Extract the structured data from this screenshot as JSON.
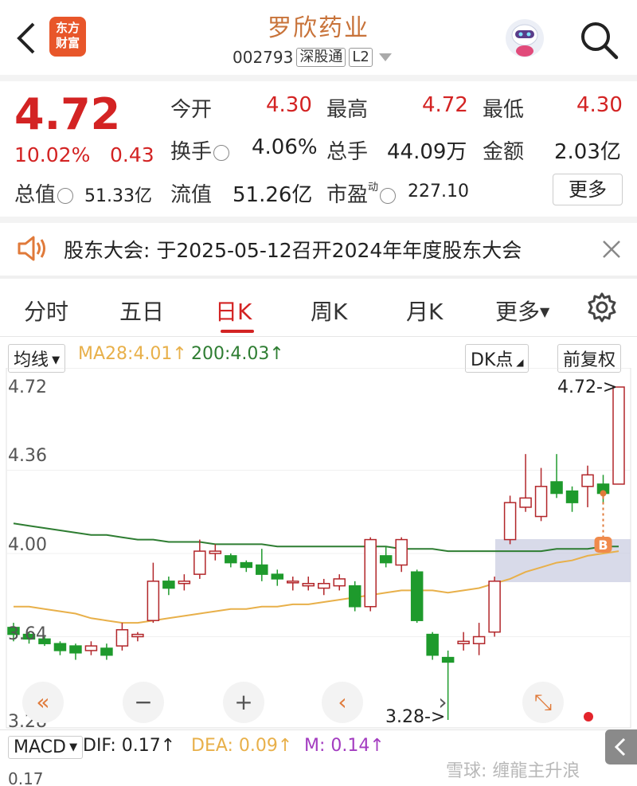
{
  "header": {
    "back_icon": "chevron-left-icon",
    "app_logo_line1": "东方",
    "app_logo_line2": "财富",
    "title": "罗欣药业",
    "code": "002793",
    "tag_connect": "深股通",
    "tag_level": "L2",
    "search_icon": "search-icon",
    "robot_icon": "robot-avatar-icon"
  },
  "quote": {
    "price": "4.72",
    "change_pct": "10.02%",
    "change_abs": "0.43",
    "open_label": "今开",
    "open": "4.30",
    "high_label": "最高",
    "high": "4.72",
    "low_label": "最低",
    "low": "4.30",
    "turnover_label": "换手",
    "turnover": "4.06%",
    "volume_label": "总手",
    "volume": "44.09万",
    "amount_label": "金额",
    "amount": "2.03亿",
    "mktcap_label": "总值",
    "mktcap": "51.33亿",
    "float_label": "流值",
    "float": "51.26亿",
    "pe_label": "市盈",
    "pe_sup": "动",
    "pe": "227.10",
    "more_label": "更多"
  },
  "notice": {
    "text": "股东大会: 于2025-05-12召开2024年年度股东大会"
  },
  "tabs": [
    "分时",
    "五日",
    "日K",
    "周K",
    "月K",
    "更多"
  ],
  "active_tab": "日K",
  "ma": {
    "selector": "均线",
    "ma28": "MA28:4.01",
    "ma200": "200:4.03",
    "dk_label": "DK点",
    "adjust_label": "前复权"
  },
  "chart_data": {
    "type": "candlestick",
    "y_ticks": [
      "4.72",
      "4.36",
      "4.00",
      "3.64",
      "3.28"
    ],
    "ylim": [
      3.28,
      4.72
    ],
    "max_marker": "4.72->",
    "min_marker": "3.28->",
    "buy_marker": "B",
    "candles": [
      {
        "o": 3.68,
        "c": 3.65,
        "h": 3.7,
        "l": 3.62
      },
      {
        "o": 3.65,
        "c": 3.63,
        "h": 3.66,
        "l": 3.61
      },
      {
        "o": 3.63,
        "c": 3.61,
        "h": 3.64,
        "l": 3.6
      },
      {
        "o": 3.61,
        "c": 3.58,
        "h": 3.62,
        "l": 3.56
      },
      {
        "o": 3.6,
        "c": 3.57,
        "h": 3.61,
        "l": 3.54
      },
      {
        "o": 3.58,
        "c": 3.6,
        "h": 3.62,
        "l": 3.56
      },
      {
        "o": 3.59,
        "c": 3.56,
        "h": 3.61,
        "l": 3.54
      },
      {
        "o": 3.6,
        "c": 3.67,
        "h": 3.7,
        "l": 3.58
      },
      {
        "o": 3.64,
        "c": 3.65,
        "h": 3.66,
        "l": 3.62
      },
      {
        "o": 3.71,
        "c": 3.88,
        "h": 3.96,
        "l": 3.7
      },
      {
        "o": 3.88,
        "c": 3.85,
        "h": 3.9,
        "l": 3.82
      },
      {
        "o": 3.87,
        "c": 3.88,
        "h": 3.91,
        "l": 3.84
      },
      {
        "o": 3.91,
        "c": 4.01,
        "h": 4.06,
        "l": 3.89
      },
      {
        "o": 4.0,
        "c": 4.01,
        "h": 4.04,
        "l": 3.97
      },
      {
        "o": 3.99,
        "c": 3.96,
        "h": 4.0,
        "l": 3.94
      },
      {
        "o": 3.96,
        "c": 3.94,
        "h": 3.97,
        "l": 3.92
      },
      {
        "o": 3.95,
        "c": 3.91,
        "h": 4.02,
        "l": 3.88
      },
      {
        "o": 3.91,
        "c": 3.89,
        "h": 3.93,
        "l": 3.86
      },
      {
        "o": 3.88,
        "c": 3.88,
        "h": 3.9,
        "l": 3.84
      },
      {
        "o": 3.86,
        "c": 3.87,
        "h": 3.9,
        "l": 3.84
      },
      {
        "o": 3.85,
        "c": 3.87,
        "h": 3.89,
        "l": 3.82
      },
      {
        "o": 3.86,
        "c": 3.89,
        "h": 3.91,
        "l": 3.84
      },
      {
        "o": 3.86,
        "c": 3.77,
        "h": 3.88,
        "l": 3.75
      },
      {
        "o": 3.77,
        "c": 4.06,
        "h": 4.07,
        "l": 3.75
      },
      {
        "o": 3.99,
        "c": 3.96,
        "h": 4.03,
        "l": 3.94
      },
      {
        "o": 3.95,
        "c": 4.06,
        "h": 4.07,
        "l": 3.92
      },
      {
        "o": 3.92,
        "c": 3.71,
        "h": 3.93,
        "l": 3.7
      },
      {
        "o": 3.65,
        "c": 3.56,
        "h": 3.66,
        "l": 3.54
      },
      {
        "o": 3.55,
        "c": 3.53,
        "h": 3.58,
        "l": 3.28
      },
      {
        "o": 3.61,
        "c": 3.62,
        "h": 3.66,
        "l": 3.58
      },
      {
        "o": 3.61,
        "c": 3.64,
        "h": 3.7,
        "l": 3.56
      },
      {
        "o": 3.66,
        "c": 3.88,
        "h": 3.9,
        "l": 3.64
      },
      {
        "o": 4.06,
        "c": 4.22,
        "h": 4.25,
        "l": 4.04
      },
      {
        "o": 4.2,
        "c": 4.24,
        "h": 4.43,
        "l": 4.18
      },
      {
        "o": 4.16,
        "c": 4.29,
        "h": 4.37,
        "l": 4.14
      },
      {
        "o": 4.31,
        "c": 4.26,
        "h": 4.43,
        "l": 4.24
      },
      {
        "o": 4.27,
        "c": 4.22,
        "h": 4.29,
        "l": 4.18
      },
      {
        "o": 4.29,
        "c": 4.34,
        "h": 4.38,
        "l": 4.2
      },
      {
        "o": 4.3,
        "c": 4.26,
        "h": 4.34,
        "l": 4.22
      },
      {
        "o": 4.3,
        "c": 4.72,
        "h": 4.72,
        "l": 4.3
      }
    ],
    "ma28": [
      3.77,
      3.77,
      3.76,
      3.75,
      3.74,
      3.72,
      3.71,
      3.7,
      3.7,
      3.71,
      3.72,
      3.73,
      3.74,
      3.75,
      3.76,
      3.76,
      3.77,
      3.77,
      3.78,
      3.78,
      3.79,
      3.8,
      3.81,
      3.82,
      3.83,
      3.84,
      3.84,
      3.84,
      3.83,
      3.84,
      3.85,
      3.87,
      3.89,
      3.92,
      3.94,
      3.96,
      3.97,
      3.99,
      4.0,
      4.01
    ],
    "ma200": [
      4.13,
      4.12,
      4.11,
      4.1,
      4.09,
      4.08,
      4.08,
      4.07,
      4.06,
      4.06,
      4.05,
      4.05,
      4.05,
      4.04,
      4.04,
      4.04,
      4.04,
      4.03,
      4.03,
      4.03,
      4.03,
      4.03,
      4.03,
      4.03,
      4.03,
      4.02,
      4.02,
      4.02,
      4.01,
      4.01,
      4.01,
      4.01,
      4.01,
      4.01,
      4.01,
      4.02,
      4.02,
      4.02,
      4.03,
      4.03
    ]
  },
  "controls": [
    "«",
    "−",
    "+",
    "‹",
    "›",
    "⤡"
  ],
  "macd": {
    "selector": "MACD",
    "dif": "DIF: 0.17",
    "dea": "DEA: 0.09",
    "m": "M: 0.14",
    "axis_top": "0.17"
  },
  "watermark": "雪球: 缠龍主升浪",
  "colors": {
    "up": "#b2262a",
    "down": "#1e9a2c",
    "ma28": "#e8b04a",
    "ma200": "#2e7d32",
    "accent": "#d32323"
  }
}
